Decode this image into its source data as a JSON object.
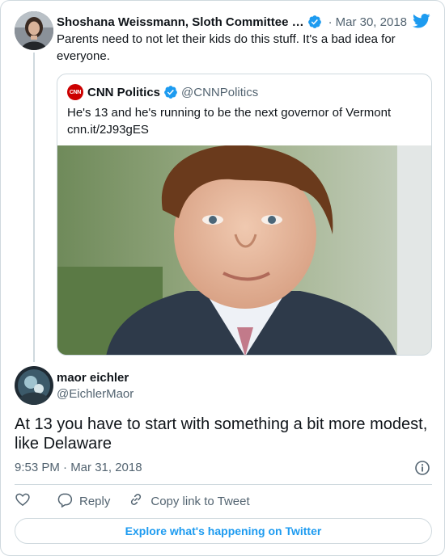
{
  "parent_tweet": {
    "author_name": "Shoshana Weissmann, Sloth Committee …",
    "date": "Mar 30, 2018",
    "separator": "·",
    "text": "Parents need to not let their kids do this stuff. It's a bad idea for everyone."
  },
  "quoted_tweet": {
    "logo_text": "CNN",
    "author_name": "CNN Politics",
    "handle": "@CNNPolitics",
    "text": "He's 13 and he's running to be the next governor of Vermont",
    "link": "cnn.it/2J93gES"
  },
  "reply_tweet": {
    "author_name": "maor eichler",
    "handle": "@EichlerMaor",
    "text": "At 13 you have to start with something a bit more modest, like Delaware",
    "timestamp": "9:53 PM · Mar 31, 2018"
  },
  "actions": {
    "like_icon": "heart-icon",
    "reply_label": "Reply",
    "copy_link_label": "Copy link to Tweet"
  },
  "footer": {
    "explore_label": "Explore what's happening on Twitter"
  },
  "colors": {
    "accent": "#1d9bf0",
    "text_primary": "#0f1419",
    "text_secondary": "#536471",
    "border": "#cfd9de",
    "cnn_red": "#cc0000"
  }
}
